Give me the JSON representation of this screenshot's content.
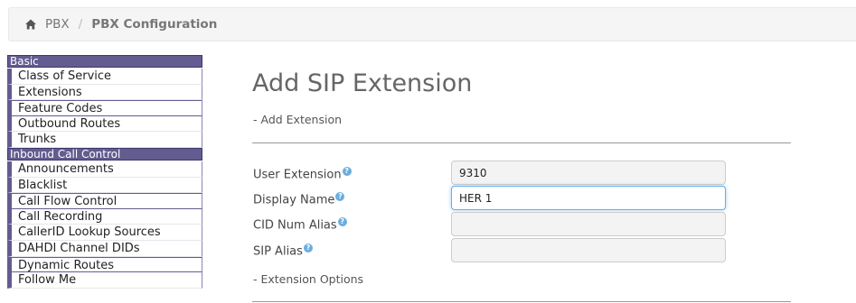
{
  "breadcrumb": {
    "items": [
      "PBX",
      "PBX Configuration"
    ],
    "separator": "/"
  },
  "sidebar": {
    "sections": [
      {
        "header": "Basic",
        "items": [
          "Class of Service",
          "Extensions",
          "Feature Codes",
          "Outbound Routes",
          "Trunks"
        ]
      },
      {
        "header": "Inbound Call Control",
        "items": [
          "Announcements",
          "Blacklist",
          "Call Flow Control",
          "Call Recording",
          "CallerID Lookup Sources",
          "DAHDI Channel DIDs",
          "Dynamic Routes",
          "Follow Me"
        ]
      }
    ]
  },
  "page": {
    "title": "Add SIP Extension",
    "section1": "- Add Extension",
    "section2": "- Extension Options"
  },
  "form": {
    "user_extension": {
      "label": "User Extension",
      "value": "9310"
    },
    "display_name": {
      "label": "Display Name",
      "value": "HER 1"
    },
    "cid_num_alias": {
      "label": "CID Num Alias",
      "value": ""
    },
    "sip_alias": {
      "label": "SIP Alias",
      "value": ""
    },
    "help_glyph": "?"
  },
  "colors": {
    "sidebar_accent": "#625c90",
    "focus": "#66afe9",
    "help_icon": "#6aaee0"
  }
}
